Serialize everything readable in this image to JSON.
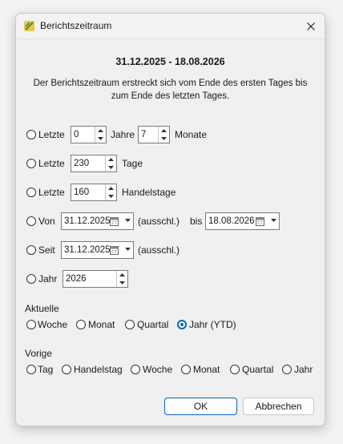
{
  "dialog": {
    "title": "Berichtszeitraum",
    "heading": "31.12.2025 - 18.08.2026",
    "description_line1": "Der Berichtszeitraum erstreckt sich vom Ende des ersten Tages bis",
    "description_line2": "zum Ende des letzten Tages."
  },
  "options": {
    "row1": {
      "label": "Letzte",
      "years_value": "0",
      "years_unit": "Jahre",
      "months_value": "7",
      "months_unit": "Monate"
    },
    "row2": {
      "label": "Letzte",
      "value": "230",
      "unit": "Tage"
    },
    "row3": {
      "label": "Letzte",
      "value": "160",
      "unit": "Handelstage"
    },
    "row4": {
      "label": "Von",
      "from_date": "31.12.2025",
      "exclusive": "(ausschl.)",
      "to_label": "bis",
      "to_date": "18.08.2026"
    },
    "row5": {
      "label": "Seit",
      "date": "31.12.2025",
      "exclusive": "(ausschl.)"
    },
    "row6": {
      "label": "Jahr",
      "value": "2026"
    }
  },
  "current": {
    "title": "Aktuelle",
    "items": [
      "Woche",
      "Monat",
      "Quartal",
      "Jahr (YTD)"
    ],
    "selected": "Jahr (YTD)"
  },
  "previous": {
    "title": "Vorige",
    "items": [
      "Tag",
      "Handelstag",
      "Woche",
      "Monat",
      "Quartal",
      "Jahr"
    ]
  },
  "buttons": {
    "ok": "OK",
    "cancel": "Abbrechen"
  },
  "colors": {
    "accent": "#0067c0",
    "background": "#f0f0f0"
  }
}
